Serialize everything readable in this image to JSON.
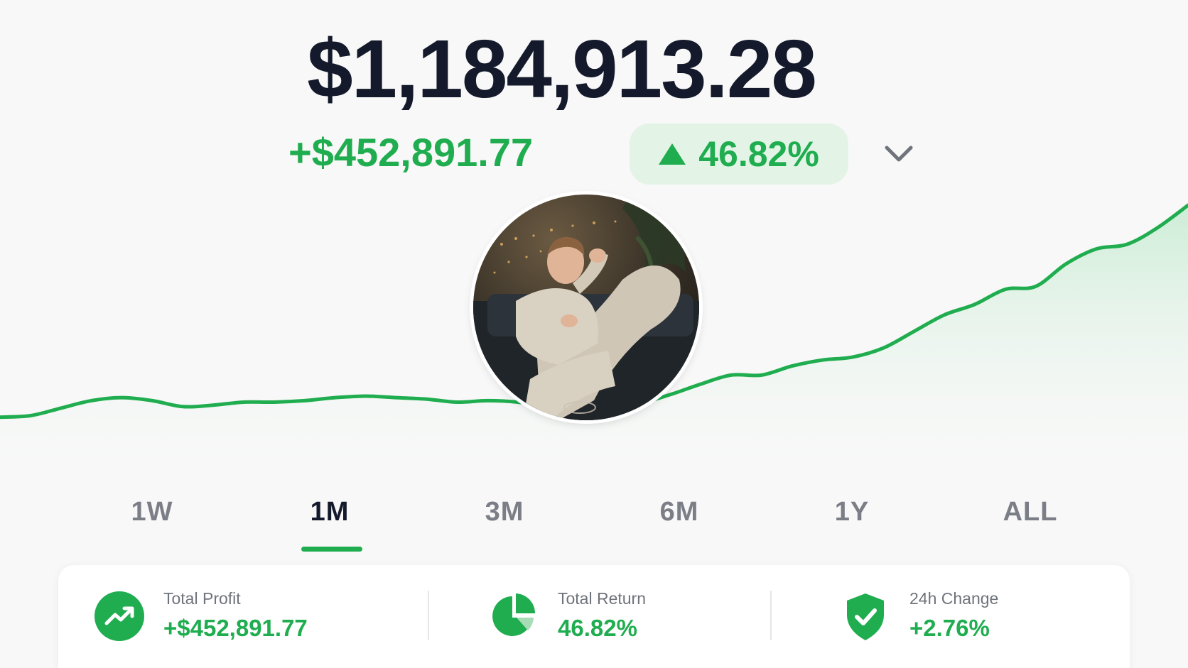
{
  "portfolio": {
    "balance": "$1,184,913.28",
    "profit": "+$452,891.77",
    "percent_change": "46.82%",
    "trend": "up"
  },
  "chart_data": {
    "type": "area",
    "title": "",
    "xlabel": "",
    "ylabel": "",
    "series": [
      {
        "values": [
          20,
          21,
          26,
          31,
          33,
          31,
          27,
          28,
          30,
          30,
          31,
          33,
          34,
          33,
          32,
          30,
          31,
          30,
          27,
          30,
          33,
          30,
          35,
          42,
          48,
          48,
          54,
          58,
          60,
          66,
          77,
          88,
          95,
          105,
          107,
          122,
          132,
          135,
          146,
          161
        ]
      }
    ],
    "ylim": [
      0,
      170
    ],
    "grid": false,
    "colors": {
      "line": "#1fad4f",
      "fill_top": "#c8ecd3"
    }
  },
  "tabs": [
    {
      "label": "1W",
      "active": false
    },
    {
      "label": "1M",
      "active": true
    },
    {
      "label": "3M",
      "active": false
    },
    {
      "label": "6M",
      "active": false
    },
    {
      "label": "1Y",
      "active": false
    },
    {
      "label": "ALL",
      "active": false
    }
  ],
  "stats": [
    {
      "label": "Total Profit",
      "value": "+$452,891.77",
      "icon": "trending-up-icon"
    },
    {
      "label": "Total Return",
      "value": "46.82%",
      "icon": "pie-chart-icon"
    },
    {
      "label": "24h Change",
      "value": "+2.76%",
      "icon": "shield-check-icon"
    }
  ],
  "colors": {
    "accent": "#1fad4f",
    "accent_bg": "#e3f4e7",
    "text_dark": "#141a2b",
    "text_muted": "#7b7e86"
  }
}
